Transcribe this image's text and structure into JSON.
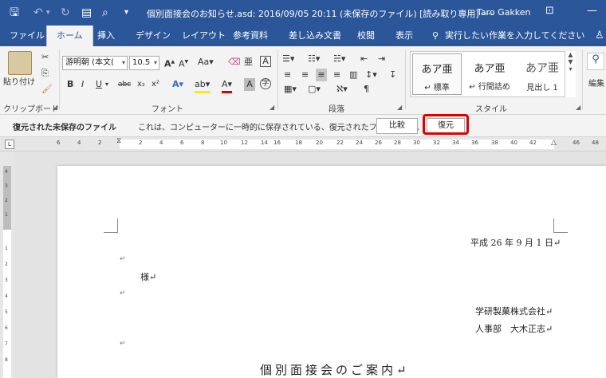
{
  "window": {
    "title": "個別面接会のお知らせ.asd: 2016/09/05 20:11 (未保存のファイル) [読み取り専用] -···",
    "user": "Taro Gakken"
  },
  "tabs": [
    "ファイル",
    "ホーム",
    "挿入",
    "デザイン",
    "レイアウト",
    "参考資料",
    "差し込み文書",
    "校閲",
    "表示"
  ],
  "tell_me": "実行したい作業を入力してください",
  "ribbon": {
    "clipboard": {
      "paste_label": "貼り付け",
      "group_label": "クリップボード"
    },
    "font": {
      "font_name": "游明朝 (本文(",
      "font_size": "10.5",
      "group_label": "フォント"
    },
    "paragraph": {
      "group_label": "段落"
    },
    "styles": {
      "group_label": "スタイル",
      "items": [
        {
          "sample": "あア亜",
          "name": "↵ 標準"
        },
        {
          "sample": "あア亜",
          "name": "↵ 行間詰め"
        },
        {
          "sample": "あア亜",
          "name": "見出し 1"
        }
      ]
    },
    "editing": {
      "label": "編集"
    }
  },
  "infobar": {
    "title": "復元された未保存のファイル",
    "message": "これは、コンピューターに一時的に保存されている、復元されたファイルです。",
    "compare_label": "比較",
    "restore_label": "復元"
  },
  "ruler": {
    "h_numbers": [
      "6",
      "4",
      "2",
      "2",
      "4",
      "6",
      "8",
      "10",
      "12",
      "14",
      "16",
      "18",
      "20",
      "22",
      "24",
      "26",
      "28",
      "30",
      "32",
      "34",
      "36",
      "38",
      "40",
      "42",
      "46",
      "48"
    ],
    "v_numbers": [
      "4",
      "3",
      "2",
      "1",
      "1",
      "2",
      "3",
      "4",
      "5",
      "6",
      "7",
      "8"
    ]
  },
  "document": {
    "date": "平成 26 年 9 月 1 日↵",
    "para1": "↵",
    "addressee": "様↵",
    "para2": "↵",
    "company": "学研製菓株式会社↵",
    "department": "人事部　大木正志↵",
    "para3": "↵",
    "heading": "個別面接会のご案内↵"
  }
}
